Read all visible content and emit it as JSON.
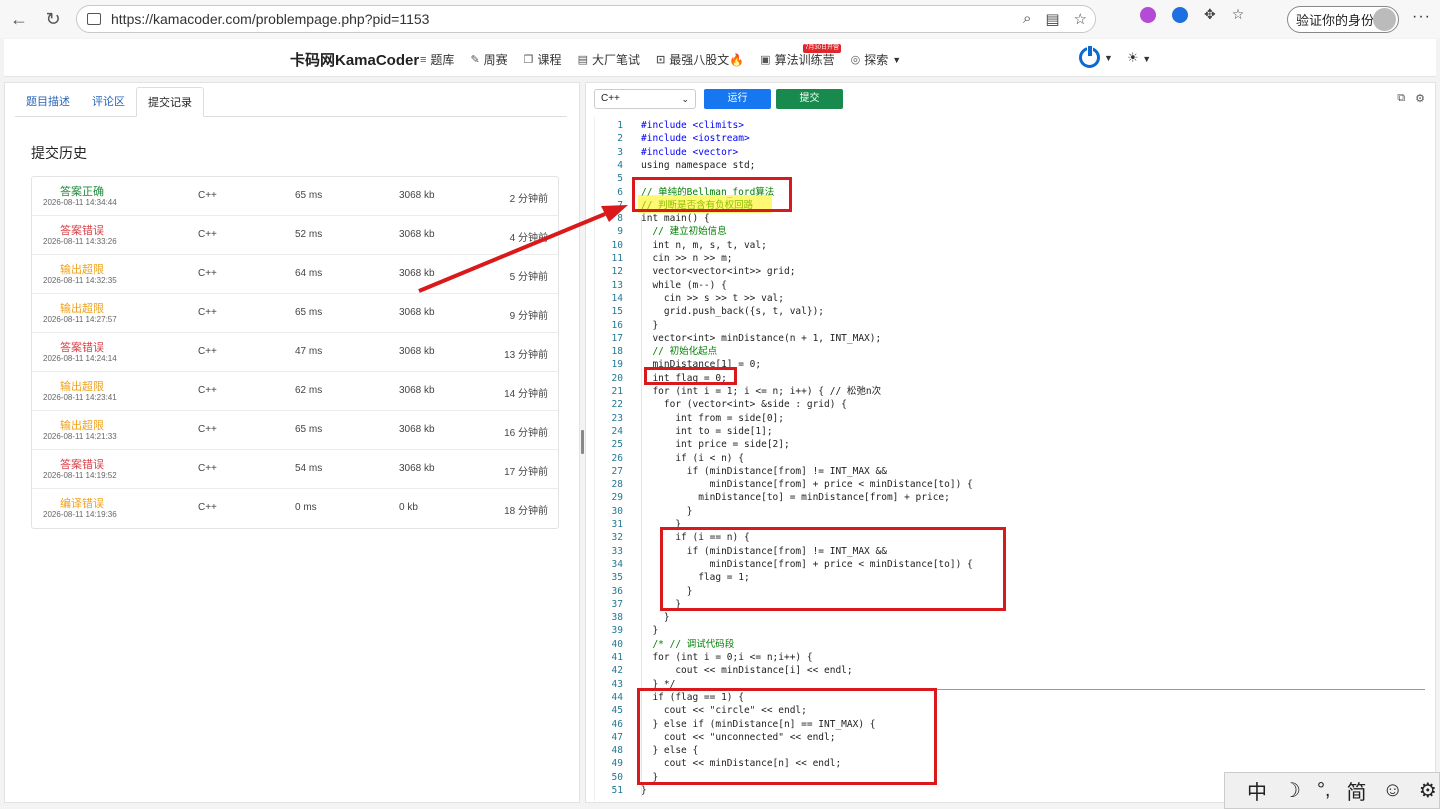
{
  "browser": {
    "url": "https://kamacoder.com/problempage.php?pid=1153",
    "profile_label": "验证你的身份"
  },
  "site": {
    "brand": "卡码网KamaCoder",
    "nav": [
      {
        "label": "题库",
        "icon": "list-icon"
      },
      {
        "label": "周赛",
        "icon": "pen-icon"
      },
      {
        "label": "课程",
        "icon": "book-icon"
      },
      {
        "label": "大厂笔试",
        "icon": "doc-icon"
      },
      {
        "label": "最强八股文🔥",
        "icon": "code-icon"
      },
      {
        "label": "算法训练营",
        "icon": "calendar-icon"
      },
      {
        "label": "探索",
        "icon": "compass-icon"
      }
    ],
    "camp_badge": "7月30日开营"
  },
  "left": {
    "tabs": [
      {
        "label": "题目描述",
        "active": false
      },
      {
        "label": "评论区",
        "active": false
      },
      {
        "label": "提交记录",
        "active": true
      }
    ],
    "history_title": "提交历史",
    "submissions": [
      {
        "status": "答案正确",
        "kind": "ok",
        "time_stamp": "2026-08-11 14:34:44",
        "lang": "C++",
        "runtime": "65 ms",
        "memory": "3068 kb",
        "ago": "2 分钟前"
      },
      {
        "status": "答案错误",
        "kind": "wrong",
        "time_stamp": "2026-08-11 14:33:26",
        "lang": "C++",
        "runtime": "52 ms",
        "memory": "3068 kb",
        "ago": "4 分钟前"
      },
      {
        "status": "输出超限",
        "kind": "ole",
        "time_stamp": "2026-08-11 14:32:35",
        "lang": "C++",
        "runtime": "64 ms",
        "memory": "3068 kb",
        "ago": "5 分钟前"
      },
      {
        "status": "输出超限",
        "kind": "ole",
        "time_stamp": "2026-08-11 14:27:57",
        "lang": "C++",
        "runtime": "65 ms",
        "memory": "3068 kb",
        "ago": "9 分钟前"
      },
      {
        "status": "答案错误",
        "kind": "wrong",
        "time_stamp": "2026-08-11 14:24:14",
        "lang": "C++",
        "runtime": "47 ms",
        "memory": "3068 kb",
        "ago": "13 分钟前"
      },
      {
        "status": "输出超限",
        "kind": "ole",
        "time_stamp": "2026-08-11 14:23:41",
        "lang": "C++",
        "runtime": "62 ms",
        "memory": "3068 kb",
        "ago": "14 分钟前"
      },
      {
        "status": "输出超限",
        "kind": "ole",
        "time_stamp": "2026-08-11 14:21:33",
        "lang": "C++",
        "runtime": "65 ms",
        "memory": "3068 kb",
        "ago": "16 分钟前"
      },
      {
        "status": "答案错误",
        "kind": "wrong",
        "time_stamp": "2026-08-11 14:19:52",
        "lang": "C++",
        "runtime": "54 ms",
        "memory": "3068 kb",
        "ago": "17 分钟前"
      },
      {
        "status": "编译错误",
        "kind": "ole",
        "time_stamp": "2026-08-11 14:19:36",
        "lang": "C++",
        "runtime": "0 ms",
        "memory": "0 kb",
        "ago": "18 分钟前"
      }
    ]
  },
  "editor": {
    "language": "C++",
    "run_label": "运行",
    "submit_label": "提交",
    "lines": [
      "#include <climits>",
      "#include <iostream>",
      "#include <vector>",
      "using namespace std;",
      "",
      "// 单纯的Bellman_ford算法",
      "// 判断是否含有负权回路",
      "int main() {",
      "  // 建立初始信息",
      "  int n, m, s, t, val;",
      "  cin >> n >> m;",
      "  vector<vector<int>> grid;",
      "  while (m--) {",
      "    cin >> s >> t >> val;",
      "    grid.push_back({s, t, val});",
      "  }",
      "  vector<int> minDistance(n + 1, INT_MAX);",
      "  // 初始化起点",
      "  minDistance[1] = 0;",
      "  int flag = 0;",
      "  for (int i = 1; i <= n; i++) { // 松弛n次",
      "    for (vector<int> &side : grid) {",
      "      int from = side[0];",
      "      int to = side[1];",
      "      int price = side[2];",
      "      if (i < n) {",
      "        if (minDistance[from] != INT_MAX &&",
      "            minDistance[from] + price < minDistance[to]) {",
      "          minDistance[to] = minDistance[from] + price;",
      "        }",
      "      }",
      "      if (i == n) {",
      "        if (minDistance[from] != INT_MAX &&",
      "            minDistance[from] + price < minDistance[to]) {",
      "          flag = 1;",
      "        }",
      "      }",
      "    }",
      "  }",
      "  /* // 调试代码段",
      "  for (int i = 0;i <= n;i++) {",
      "      cout << minDistance[i] << endl;",
      "  } */",
      "  if (flag == 1) {",
      "    cout << \"circle\" << endl;",
      "  } else if (minDistance[n] == INT_MAX) {",
      "    cout << \"unconnected\" << endl;",
      "  } else {",
      "    cout << minDistance[n] << endl;",
      "  }",
      "}"
    ]
  },
  "ime": {
    "mode": "中",
    "moon": "☽",
    "punct": "°,",
    "script": "简",
    "emoji": "☺",
    "settings": "⚙"
  },
  "colors": {
    "accent_blue": "#1677f0",
    "submit_green": "#198a4d",
    "ok": "#1f8b3a",
    "wrong": "#d9434a",
    "ole": "#f0a21a",
    "annotation_red": "#d9191c",
    "highlight_yellow": "#fff200"
  }
}
